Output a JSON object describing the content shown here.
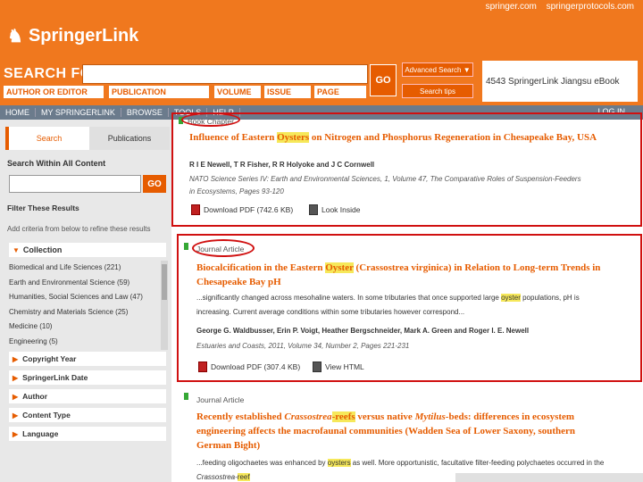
{
  "header": {
    "links": [
      "springer.com",
      "springerprotocols.com"
    ],
    "logo": "SpringerLink",
    "search_for": "SEARCH FOR",
    "go": "GO",
    "advanced_search": "Advanced Search ▼",
    "search_tips": "Search tips",
    "institution": "4543 SpringerLink Jiangsu eBook",
    "fields": {
      "author": "AUTHOR OR EDITOR",
      "publication": "PUBLICATION",
      "volume": "VOLUME",
      "issue": "ISSUE",
      "page": "PAGE"
    }
  },
  "nav": {
    "items": [
      "HOME",
      "MY SPRINGERLINK",
      "BROWSE",
      "TOOLS",
      "HELP"
    ],
    "login": "LOG IN"
  },
  "sidebar": {
    "tab_search": "Search",
    "tab_publications": "Publications",
    "search_within": "Search Within All Content",
    "go": "GO",
    "filter_title": "Filter These Results",
    "filter_desc": "Add criteria from below to refine these results",
    "collection": "Collection",
    "collection_items": [
      "Biomedical and Life Sciences (221)",
      "Earth and Environmental Science (59)",
      "Humanities, Social Sciences and Law (47)",
      "Chemistry and Materials Science (25)",
      "Medicine (10)",
      "Engineering (5)"
    ],
    "facets": [
      "Copyright Year",
      "SpringerLink Date",
      "Author",
      "Content Type",
      "Language"
    ]
  },
  "results": [
    {
      "type": "Book Chapter",
      "title_pre": "Influence of Eastern ",
      "title_hl": "Oysters",
      "title_post": " on Nitrogen and Phosphorus Regeneration in Chesapeake Bay, USA",
      "authors": "R I E Newell, T R Fisher, R R Holyoke and J C Cornwell",
      "source_1": "NATO Science Series IV: Earth and Environmental Sciences, 1, Volume 47, The Comparative Roles of Suspension-Feeders",
      "source_2": "in Ecosystems, Pages 93-120",
      "action_1": "Download PDF (742.6 KB)",
      "action_2": "Look Inside"
    },
    {
      "type": "Journal Article",
      "title_pre": "Biocalcification in the Eastern ",
      "title_hl": "Oyster",
      "title_mid": " (Crassostrea virginica) in Relation to Long-term Trends in",
      "title_line2": "Chesapeake Bay pH",
      "snippet_1_pre": "...significantly changed across mesohaline waters. In some tributaries that once supported large ",
      "snippet_1_hl": "oyster",
      "snippet_1_post": " populations, pH is",
      "snippet_2": "increasing. Current average conditions within some tributaries however correspond...",
      "authors": "George G. Waldbusser, Erin P. Voigt, Heather Bergschneider, Mark A. Green and Roger I. E. Newell",
      "source": "Estuaries and Coasts, 2011, Volume 34, Number 2, Pages 221-231",
      "action_1": "Download PDF (307.4 KB)",
      "action_2": "View HTML"
    },
    {
      "type": "Journal Article",
      "title_1_pre": "Recently established ",
      "title_1_it": "Crassostrea",
      "title_1_hl": "-reefs",
      "title_1_post": " versus native ",
      "title_1_it2": "Mytilus",
      "title_1_end": "-beds: differences in ecosystem",
      "title_2": "engineering affects the macrofaunal communities (Wadden Sea of Lower Saxony, southern",
      "title_3": "German Bight)",
      "snippet_pre": "...feeding oligochaetes was enhanced by ",
      "snippet_hl": "oysters",
      "snippet_post": " as well. More opportunistic, facultative filter-feeding polychaetes occurred in the",
      "snippet_2_pre": "Crassostrea-",
      "snippet_2_hl": "reef"
    }
  ],
  "colors": {
    "brand_orange": "#f0781e",
    "accent_orange": "#e65c00",
    "highlight": "#f6e85a",
    "annotation_red": "#d01010"
  }
}
